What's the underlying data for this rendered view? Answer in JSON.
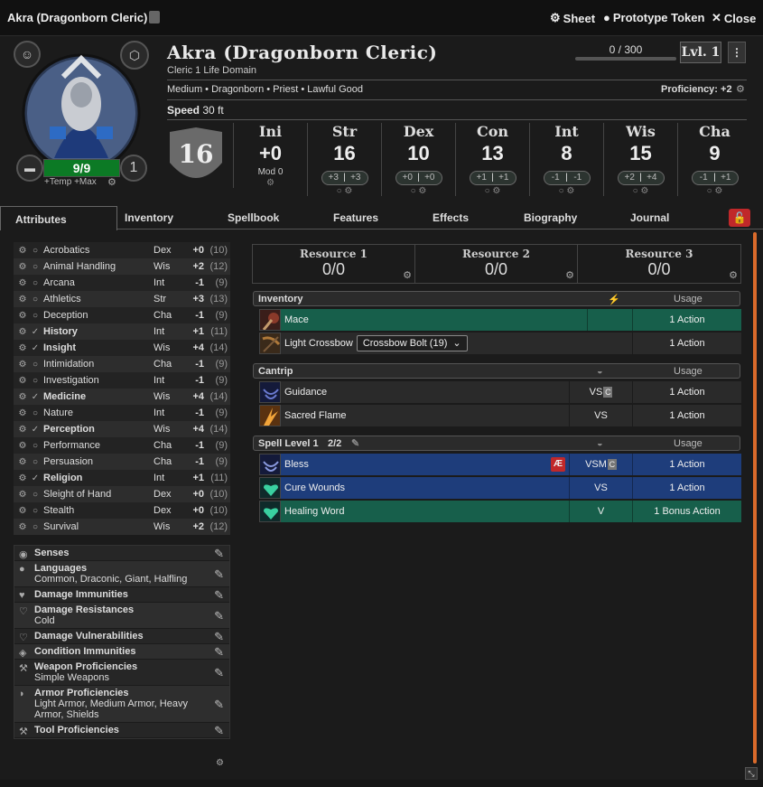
{
  "window": {
    "title": "Akra (Dragonborn Cleric)",
    "sheet_label": "Sheet",
    "token_label": "Prototype Token",
    "close_label": "Close"
  },
  "character": {
    "name": "Akra (Dragonborn Cleric)",
    "class_line": "Cleric 1 Life Domain",
    "details": "Medium • Dragonborn • Priest • Lawful Good",
    "proficiency": "Proficiency: +2",
    "speed_label": "Speed",
    "speed_value": "30 ft",
    "xp": "0 / 300",
    "level": "Lvl. 1",
    "ac": "16",
    "hp": "9/9",
    "hit_dice": "1",
    "temp_max": "+Temp +Max",
    "initiative": {
      "label": "Ini",
      "value": "+0",
      "mod_label": "Mod",
      "mod_value": "0"
    },
    "abilities": [
      {
        "label": "Str",
        "score": "16",
        "mod": "+3",
        "save": "+3"
      },
      {
        "label": "Dex",
        "score": "10",
        "mod": "+0",
        "save": "+0"
      },
      {
        "label": "Con",
        "score": "13",
        "mod": "+1",
        "save": "+1"
      },
      {
        "label": "Int",
        "score": "8",
        "mod": "-1",
        "save": "-1"
      },
      {
        "label": "Wis",
        "score": "15",
        "mod": "+2",
        "save": "+4"
      },
      {
        "label": "Cha",
        "score": "9",
        "mod": "-1",
        "save": "+1"
      }
    ]
  },
  "tabs": [
    "Attributes",
    "Inventory",
    "Spellbook",
    "Features",
    "Effects",
    "Biography",
    "Journal"
  ],
  "skills": [
    {
      "name": "Acrobatics",
      "ab": "Dex",
      "mod": "+0",
      "pass": "(10)",
      "prof": false
    },
    {
      "name": "Animal Handling",
      "ab": "Wis",
      "mod": "+2",
      "pass": "(12)",
      "prof": false
    },
    {
      "name": "Arcana",
      "ab": "Int",
      "mod": "-1",
      "pass": "(9)",
      "prof": false
    },
    {
      "name": "Athletics",
      "ab": "Str",
      "mod": "+3",
      "pass": "(13)",
      "prof": false
    },
    {
      "name": "Deception",
      "ab": "Cha",
      "mod": "-1",
      "pass": "(9)",
      "prof": false
    },
    {
      "name": "History",
      "ab": "Int",
      "mod": "+1",
      "pass": "(11)",
      "prof": true
    },
    {
      "name": "Insight",
      "ab": "Wis",
      "mod": "+4",
      "pass": "(14)",
      "prof": true
    },
    {
      "name": "Intimidation",
      "ab": "Cha",
      "mod": "-1",
      "pass": "(9)",
      "prof": false
    },
    {
      "name": "Investigation",
      "ab": "Int",
      "mod": "-1",
      "pass": "(9)",
      "prof": false
    },
    {
      "name": "Medicine",
      "ab": "Wis",
      "mod": "+4",
      "pass": "(14)",
      "prof": true
    },
    {
      "name": "Nature",
      "ab": "Int",
      "mod": "-1",
      "pass": "(9)",
      "prof": false
    },
    {
      "name": "Perception",
      "ab": "Wis",
      "mod": "+4",
      "pass": "(14)",
      "prof": true
    },
    {
      "name": "Performance",
      "ab": "Cha",
      "mod": "-1",
      "pass": "(9)",
      "prof": false
    },
    {
      "name": "Persuasion",
      "ab": "Cha",
      "mod": "-1",
      "pass": "(9)",
      "prof": false
    },
    {
      "name": "Religion",
      "ab": "Int",
      "mod": "+1",
      "pass": "(11)",
      "prof": true
    },
    {
      "name": "Sleight of Hand",
      "ab": "Dex",
      "mod": "+0",
      "pass": "(10)",
      "prof": false
    },
    {
      "name": "Stealth",
      "ab": "Dex",
      "mod": "+0",
      "pass": "(10)",
      "prof": false
    },
    {
      "name": "Survival",
      "ab": "Wis",
      "mod": "+2",
      "pass": "(12)",
      "prof": false
    }
  ],
  "traits": [
    {
      "title": "Senses",
      "value": "",
      "icon": "eye-icon"
    },
    {
      "title": "Languages",
      "value": "Common, Draconic, Giant, Halfling",
      "icon": "speech-icon"
    },
    {
      "title": "Damage Immunities",
      "value": "",
      "icon": "heart-icon"
    },
    {
      "title": "Damage Resistances",
      "value": "Cold",
      "icon": "heart-outline-icon"
    },
    {
      "title": "Damage Vulnerabilities",
      "value": "",
      "icon": "broken-heart-icon"
    },
    {
      "title": "Condition Immunities",
      "value": "",
      "icon": "shield-heart-icon"
    },
    {
      "title": "Weapon Proficiencies",
      "value": "Simple Weapons",
      "icon": "axe-icon"
    },
    {
      "title": "Armor Proficiencies",
      "value": "Light Armor, Medium Armor, Heavy Armor, Shields",
      "icon": "helmet-icon"
    },
    {
      "title": "Tool Proficiencies",
      "value": "",
      "icon": "hammer-icon"
    }
  ],
  "resources": [
    {
      "label": "Resource 1",
      "value": "0/0"
    },
    {
      "label": "Resource 2",
      "value": "0/0"
    },
    {
      "label": "Resource 3",
      "value": "0/0"
    }
  ],
  "inventory": {
    "header": "Inventory",
    "usage_label": "Usage",
    "items": [
      {
        "name": "Mace",
        "usage": "1 Action"
      },
      {
        "name": "Light Crossbow",
        "ammo": "Crossbow Bolt (19)",
        "usage": "1 Action"
      }
    ]
  },
  "cantrip": {
    "header": "Cantrip",
    "usage_label": "Usage",
    "items": [
      {
        "name": "Guidance",
        "comp": "VS",
        "usage": "1 Action"
      },
      {
        "name": "Sacred Flame",
        "comp": "VS",
        "usage": "1 Action"
      }
    ]
  },
  "level1": {
    "header": "Spell Level 1",
    "slots": "2/2",
    "usage_label": "Usage",
    "items": [
      {
        "name": "Bless",
        "comp": "VSM",
        "usage": "1 Action",
        "badge": "Æ"
      },
      {
        "name": "Cure Wounds",
        "comp": "VS",
        "usage": "1 Action"
      },
      {
        "name": "Healing Word",
        "comp": "V",
        "usage": "1 Bonus Action"
      }
    ]
  },
  "colors": {
    "accent": "#d96a2b",
    "hp_bar": "#0c7a25",
    "prepared_blue": "#1e3d7b",
    "equipped_green": "#175f4b",
    "lock_red": "#c0282a"
  }
}
